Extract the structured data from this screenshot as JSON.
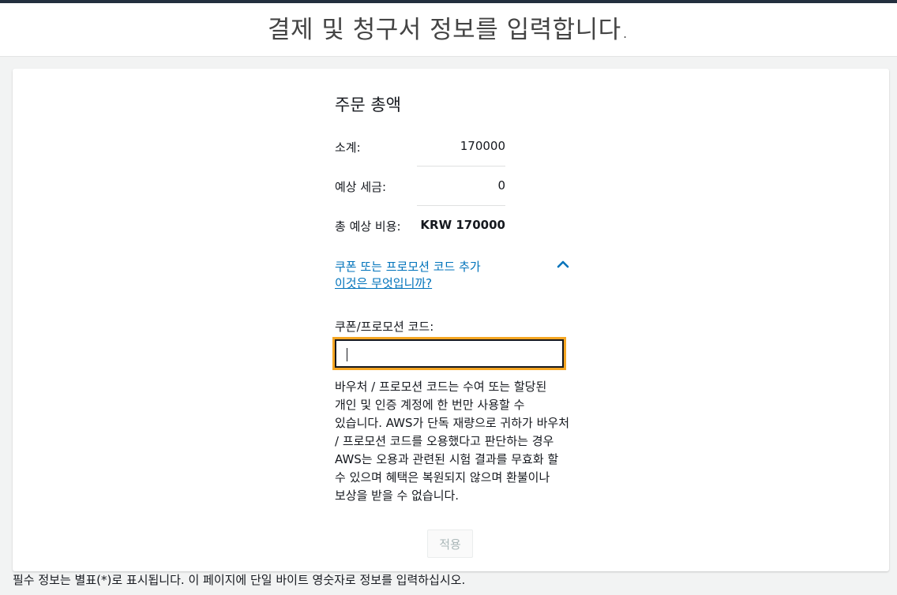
{
  "header": {
    "title": "결제 및 청구서 정보를 입력합니다."
  },
  "order_summary": {
    "title": "주문 총액",
    "subtotal_label": "소계:",
    "subtotal_value": "170000",
    "tax_label": "예상 세금:",
    "tax_value": "0",
    "total_label": "총 예상 비용:",
    "total_value": "KRW 170000"
  },
  "promo": {
    "toggle_label": "쿠폰 또는 프로모션 코드 추가",
    "whatis_link": "이것은 무엇입니까?",
    "expanded": true,
    "code_label": "쿠폰/프로모션 코드:",
    "code_value": "",
    "note": "바우처 / 프로모션 코드는 수여 또는 할당된 개인 및 인증 계정에 한 번만 사용할 수 있습니다. AWS가 단독 재량으로 귀하가 바우처 / 프로모션 코드를 오용했다고 판단하는 경우 AWS는 오용과 관련된 시험 결과를 무효화 할 수 있으며 혜택은 복원되지 않으며 환불이나 보상을 받을 수 없습니다.",
    "apply_label": "적용",
    "apply_enabled": false
  },
  "footer": {
    "required_note": "필수 정보는 별표(*)로 표시됩니다. 이 페이지에 단일 바이트 영숫자로 정보를 입력하십시오."
  },
  "colors": {
    "link": "#0073bb",
    "focus_outline": "#f5a623",
    "top_strip": "#232f3e"
  },
  "icons": {
    "promo_toggle": "chevron-up-icon"
  }
}
